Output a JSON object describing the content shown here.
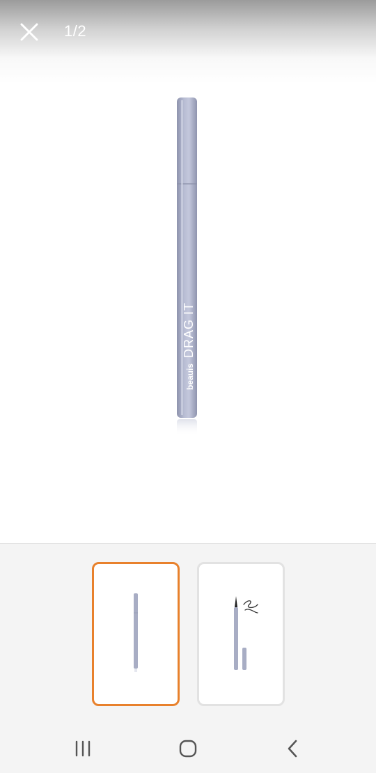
{
  "viewer": {
    "counter": "1/2",
    "close_icon": "close-icon",
    "product_brand_text": "beauis",
    "product_name_text": "DRAG IT",
    "pen_color": "#a8adc4"
  },
  "thumbnails": [
    {
      "name": "thumbnail-1",
      "selected": true,
      "border_color": "#e8812c",
      "depicts": "eyeliner-pen-closed"
    },
    {
      "name": "thumbnail-2",
      "selected": false,
      "border_color": "#e2e2e2",
      "depicts": "eyeliner-pen-open-with-swatch"
    }
  ],
  "nav_bar": {
    "recent_apps_icon": "recent-apps-icon",
    "home_icon": "home-icon",
    "back_icon": "back-icon"
  }
}
